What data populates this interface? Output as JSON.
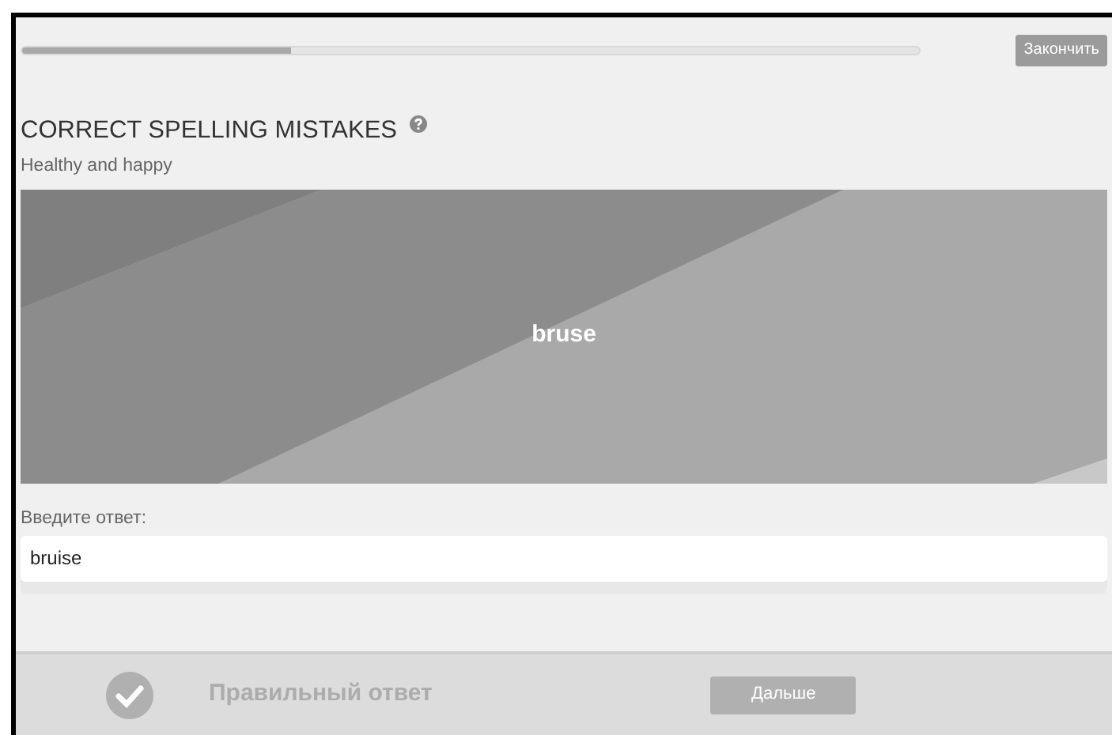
{
  "progress": {
    "level": 0.3
  },
  "finish_button": "Закончить",
  "exercise": {
    "title": "CORRECT SPELLING MISTAKES",
    "subtitle": "Healthy and happy",
    "word": "bruse"
  },
  "answer": {
    "label": "Введите ответ:",
    "value": "bruise"
  },
  "footer": {
    "status": "Правильный ответ",
    "correct": true,
    "next_button": "Дальше"
  }
}
